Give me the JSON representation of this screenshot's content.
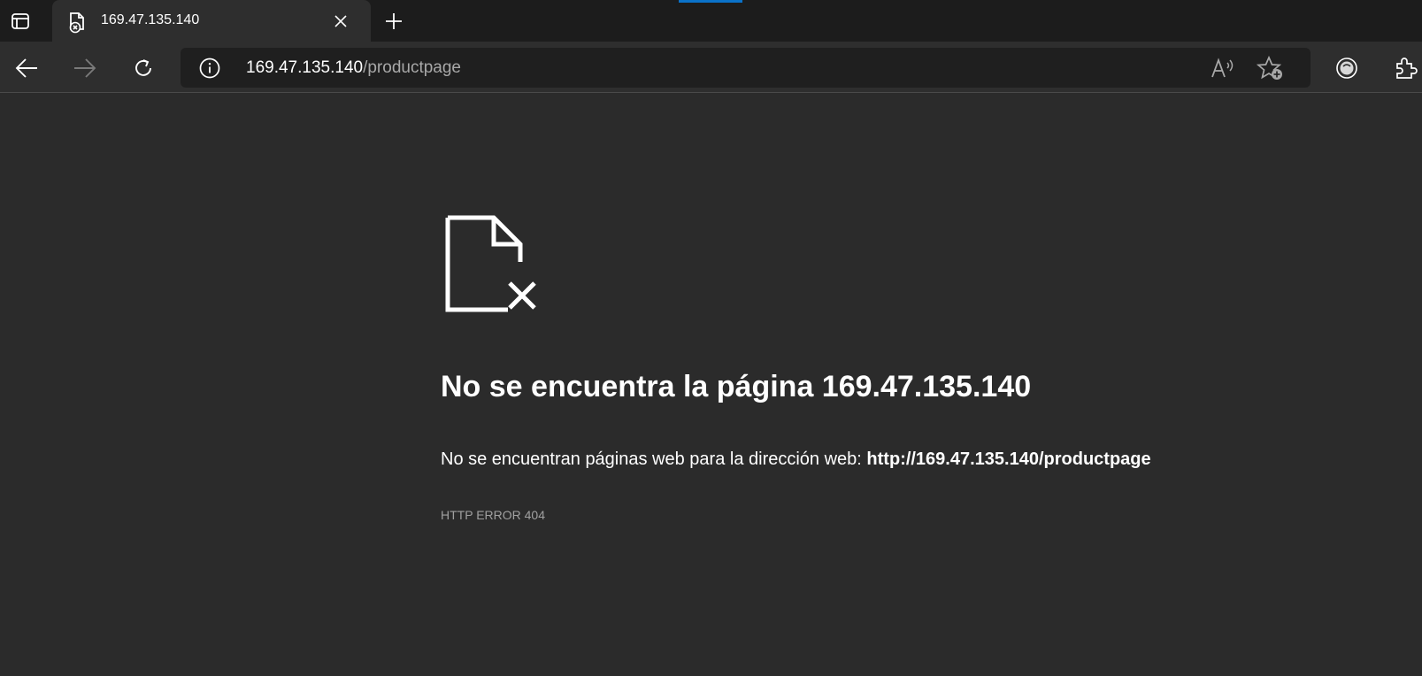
{
  "tabstrip": {
    "tab": {
      "title": "169.47.135.140",
      "favicon": "page-error-icon"
    },
    "new_tab_label": "+"
  },
  "toolbar": {
    "omnibox": {
      "host": "169.47.135.140",
      "path": "/productpage"
    }
  },
  "error": {
    "title": "No se encuentra la página 169.47.135.140",
    "description_prefix": "No se encuentran páginas web para la dirección web: ",
    "description_url": "http://169.47.135.140/productpage",
    "code": "HTTP ERROR 404"
  },
  "colors": {
    "page_bg": "#2b2b2b",
    "tabstrip_bg": "#1c1c1c",
    "accent": "#0a72c9"
  }
}
